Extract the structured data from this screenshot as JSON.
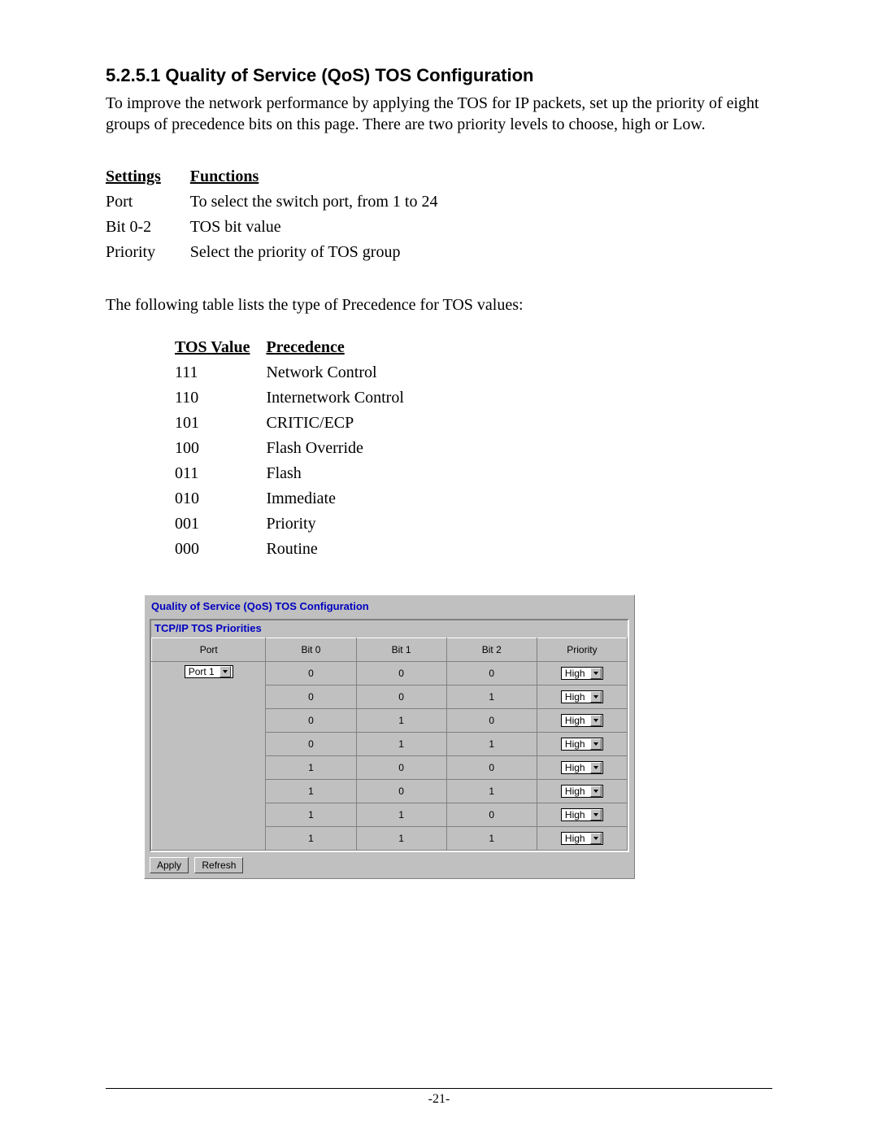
{
  "heading": "5.2.5.1 Quality of Service (QoS) TOS Configuration",
  "intro": "To improve the network performance by applying the TOS for IP packets, set up the priority of eight groups of precedence bits on this page. There are two priority levels to choose, high or Low.",
  "settings_header": {
    "c1": "Settings",
    "c2": "Functions"
  },
  "settings": [
    {
      "name": "Port",
      "func": "To select the switch port, from 1 to 24"
    },
    {
      "name": "Bit 0-2",
      "func": "TOS bit value"
    },
    {
      "name": "Priority",
      "func": "Select the priority of TOS group"
    }
  ],
  "tos_intro": "The following table lists the type of Precedence for TOS values:",
  "tos_header": {
    "c1": "TOS Value",
    "c2": "Precedence"
  },
  "tos_rows": [
    {
      "v": "111",
      "p": "Network Control"
    },
    {
      "v": "110",
      "p": "Internetwork Control"
    },
    {
      "v": "101",
      "p": "CRITIC/ECP"
    },
    {
      "v": "100",
      "p": "Flash Override"
    },
    {
      "v": "011",
      "p": "Flash"
    },
    {
      "v": "010",
      "p": "Immediate"
    },
    {
      "v": "001",
      "p": "Priority"
    },
    {
      "v": "000",
      "p": "Routine"
    }
  ],
  "ui": {
    "title": "Quality of Service (QoS) TOS Configuration",
    "subtitle": "TCP/IP TOS Priorities",
    "columns": {
      "port": "Port",
      "bit0": "Bit 0",
      "bit1": "Bit 1",
      "bit2": "Bit 2",
      "priority": "Priority"
    },
    "port_value": "Port 1",
    "rows": [
      {
        "b0": "0",
        "b1": "0",
        "b2": "0",
        "pr": "High"
      },
      {
        "b0": "0",
        "b1": "0",
        "b2": "1",
        "pr": "High"
      },
      {
        "b0": "0",
        "b1": "1",
        "b2": "0",
        "pr": "High"
      },
      {
        "b0": "0",
        "b1": "1",
        "b2": "1",
        "pr": "High"
      },
      {
        "b0": "1",
        "b1": "0",
        "b2": "0",
        "pr": "High"
      },
      {
        "b0": "1",
        "b1": "0",
        "b2": "1",
        "pr": "High"
      },
      {
        "b0": "1",
        "b1": "1",
        "b2": "0",
        "pr": "High"
      },
      {
        "b0": "1",
        "b1": "1",
        "b2": "1",
        "pr": "High"
      }
    ],
    "buttons": {
      "apply": "Apply",
      "refresh": "Refresh"
    }
  },
  "page_number": "-21-"
}
